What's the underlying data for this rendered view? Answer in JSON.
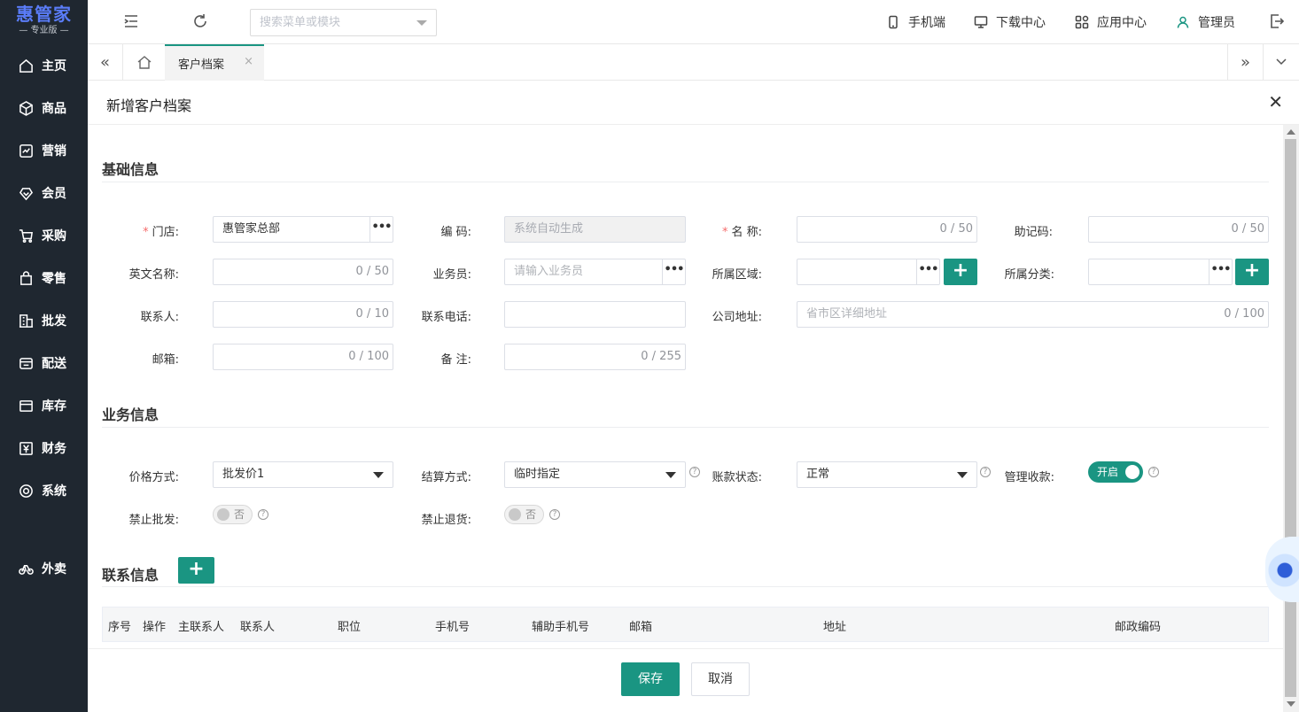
{
  "logo": {
    "title": "惠管家",
    "subtitle": "— 专业版 —"
  },
  "sidebar": {
    "items": [
      {
        "label": "主页",
        "icon": "home-icon"
      },
      {
        "label": "商品",
        "icon": "box-icon"
      },
      {
        "label": "营销",
        "icon": "chart-icon"
      },
      {
        "label": "会员",
        "icon": "member-icon"
      },
      {
        "label": "采购",
        "icon": "cart-icon"
      },
      {
        "label": "零售",
        "icon": "bag-icon"
      },
      {
        "label": "批发",
        "icon": "building-icon"
      },
      {
        "label": "配送",
        "icon": "truck-icon"
      },
      {
        "label": "库存",
        "icon": "inventory-icon"
      },
      {
        "label": "财务",
        "icon": "yen-icon"
      },
      {
        "label": "系统",
        "icon": "settings-icon"
      },
      {
        "label": "外卖",
        "icon": "bike-icon"
      }
    ]
  },
  "topbar": {
    "search_placeholder": "搜索菜单或模块",
    "mobile": "手机端",
    "download": "下载中心",
    "apps": "应用中心",
    "user": "管理员"
  },
  "tabs": {
    "active": "客户档案"
  },
  "dialog": {
    "title": "新增客户档案"
  },
  "basic": {
    "title": "基础信息",
    "store_label": "门店:",
    "store_value": "惠管家总部",
    "code_label": "编 码:",
    "code_placeholder": "系统自动生成",
    "name_label": "名 称:",
    "name_count": "0 / 50",
    "mnemonic_label": "助记码:",
    "mnemonic_count": "0 / 50",
    "en_name_label": "英文名称:",
    "en_name_count": "0 / 50",
    "salesman_label": "业务员:",
    "salesman_placeholder": "请输入业务员",
    "region_label": "所属区域:",
    "category_label": "所属分类:",
    "contact_label": "联系人:",
    "contact_count": "0 / 10",
    "phone_label": "联系电话:",
    "address_label": "公司地址:",
    "address_placeholder": "省市区详细地址",
    "address_count": "0 / 100",
    "email_label": "邮箱:",
    "email_count": "0 / 100",
    "remark_label": "备 注:",
    "remark_count": "0 / 255"
  },
  "business": {
    "title": "业务信息",
    "price_label": "价格方式:",
    "price_value": "批发价1",
    "settle_label": "结算方式:",
    "settle_value": "临时指定",
    "account_label": "账款状态:",
    "account_value": "正常",
    "collect_label": "管理收款:",
    "collect_value": "开启",
    "ban_wholesale_label": "禁止批发:",
    "ban_wholesale_value": "否",
    "ban_return_label": "禁止退货:",
    "ban_return_value": "否"
  },
  "contacts": {
    "title": "联系信息",
    "columns": [
      "序号",
      "操作",
      "主联系人",
      "联系人",
      "职位",
      "手机号",
      "辅助手机号",
      "邮箱",
      "地址",
      "邮政编码"
    ]
  },
  "footer": {
    "save": "保存",
    "cancel": "取消"
  },
  "colors": {
    "primary": "#1a9582",
    "sidebar": "#1f2730",
    "logo": "#5a7cf8"
  }
}
